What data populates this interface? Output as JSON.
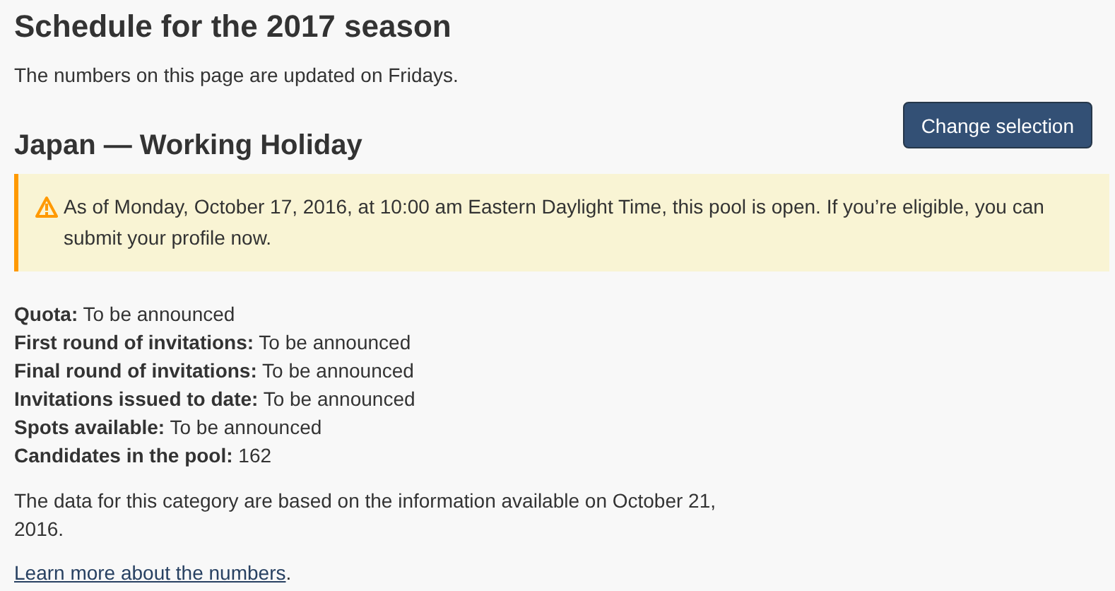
{
  "title": "Schedule for the 2017 season",
  "intro": "The numbers on this page are updated on Fridays.",
  "button": "Change selection",
  "heading": "Japan — Working Holiday",
  "alert": {
    "kind": "warning",
    "text": "As of Monday, October 17, 2016, at 10:00 am Eastern Daylight Time, this pool is open. If you’re eligible, you can submit your profile now."
  },
  "facts": [
    {
      "text": "**Quota:** To be announced"
    },
    {
      "text": "**First round of invitations:** To be announced"
    },
    {
      "text": "**Final round of invitations:** To be announced"
    },
    {
      "text": "**Invitations issued to date:** To be announced"
    },
    {
      "text": "**Spots available:** To be announced"
    },
    {
      "text": "**Candidates in the pool:** 162"
    }
  ],
  "note": "The data for this category are based on the information available on October 21, 2016.",
  "more": {
    "link": "Learn more about the numbers",
    "after": "."
  }
}
